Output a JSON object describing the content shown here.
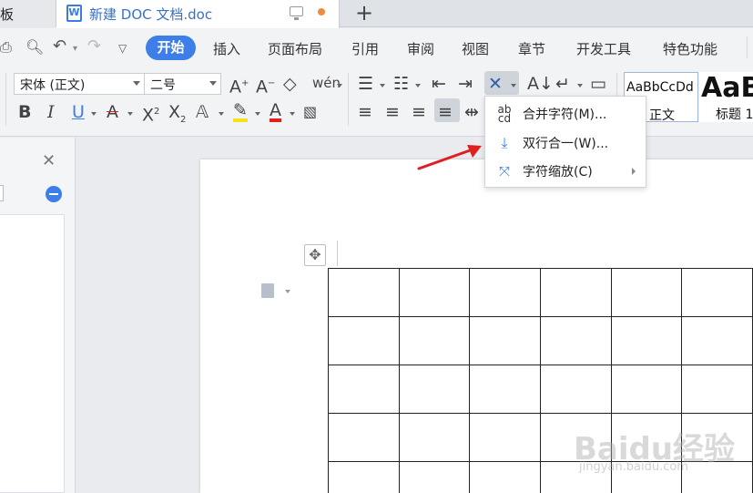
{
  "tabs": {
    "previous_tab_fragment": "板",
    "active_title": "新建 DOC 文档.doc",
    "new_tab_symbol": "+"
  },
  "menubar": {
    "items": [
      "开始",
      "插入",
      "页面布局",
      "引用",
      "审阅",
      "视图",
      "章节",
      "开发工具",
      "特色功能"
    ],
    "active": "开始"
  },
  "ribbon": {
    "font_family": "宋体 (正文)",
    "font_size": "二号",
    "style_gallery": [
      {
        "sample": "AaBbCcDd",
        "name": "正文"
      },
      {
        "sample": "AaB",
        "name": "标题 1"
      }
    ]
  },
  "dropdown": {
    "items": [
      {
        "icon": "merge-characters-icon",
        "label": "合并字符(M)..."
      },
      {
        "icon": "two-lines-in-one-icon",
        "label": "双行合一(W)..."
      },
      {
        "icon": "character-scaling-icon",
        "label": "字符缩放(C)",
        "has_submenu": true
      }
    ]
  },
  "table": {
    "rows": 5,
    "cols": 6
  },
  "colors": {
    "accent": "#3e7ee8",
    "arrow": "#e02020"
  },
  "watermark": {
    "text": "Baidu经验",
    "url": "jingyan.baidu.com"
  }
}
